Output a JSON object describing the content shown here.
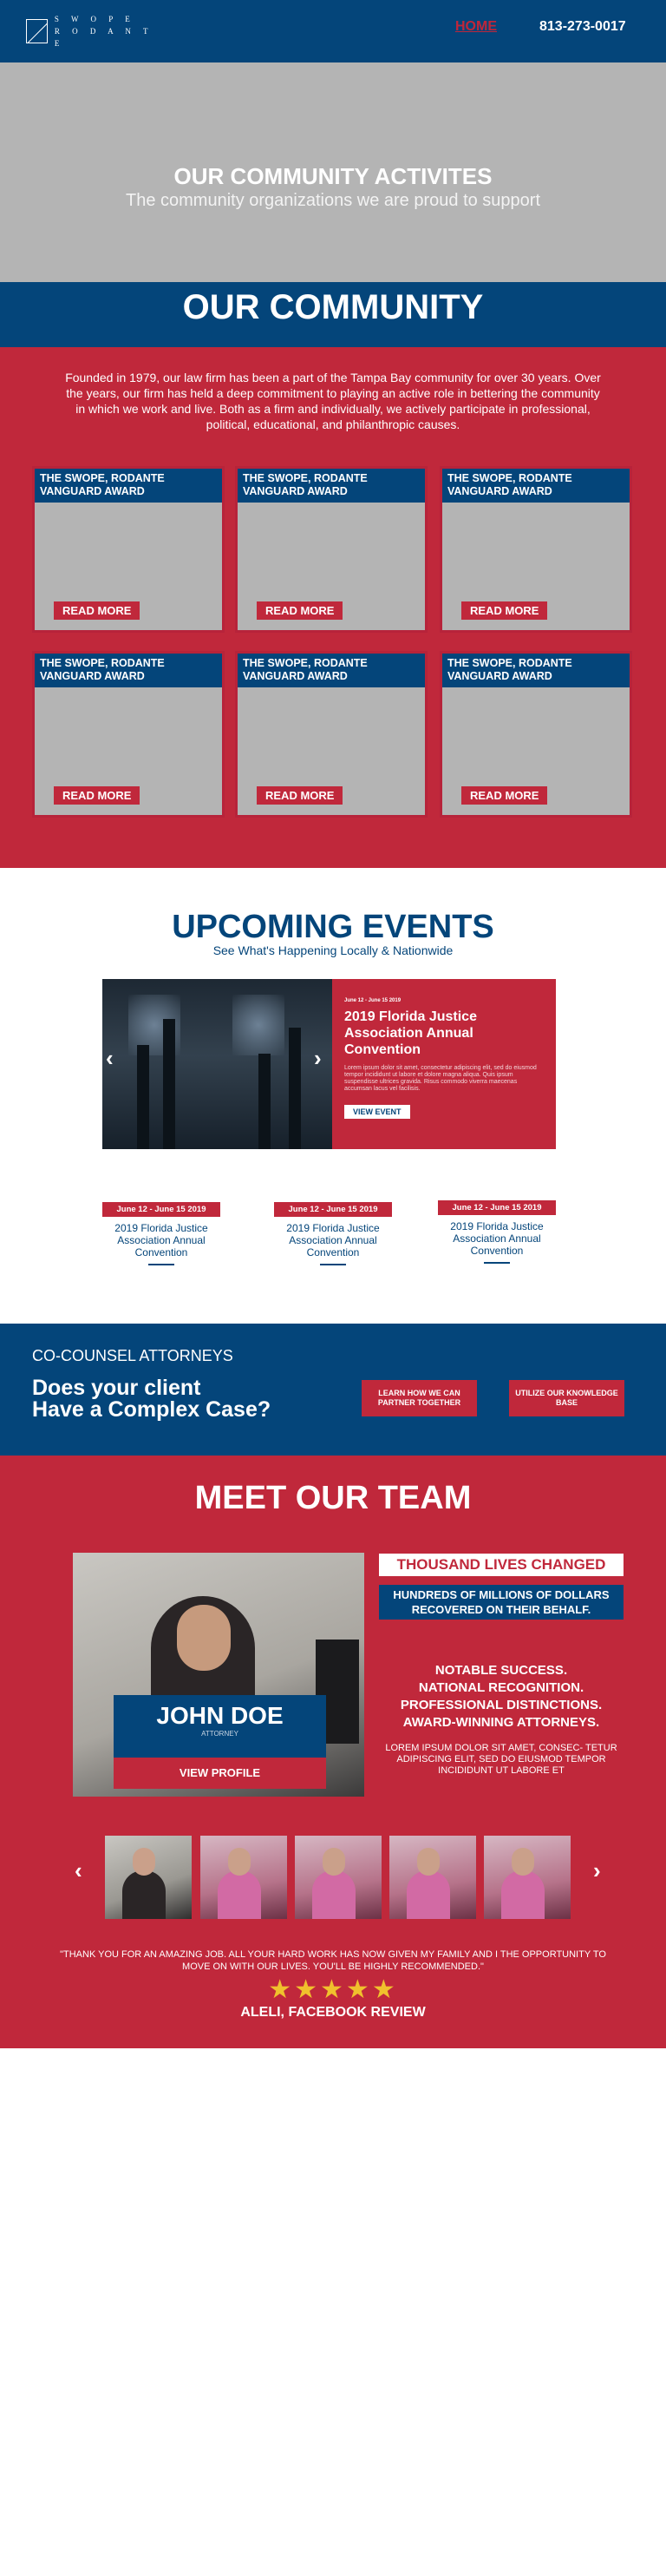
{
  "colors": {
    "brand_blue": "#04457a",
    "brand_red": "#c0283b",
    "gray": "#b4b4b4",
    "star": "#f0c12d"
  },
  "header": {
    "logo_top": "S W O P E",
    "logo_bottom": "R O D A N T E",
    "nav_home": "HOME",
    "phone": "813-273-0017"
  },
  "hero": {
    "title": "OUR COMMUNITY ACTIVITES",
    "subtitle": "The community organizations we are proud to support"
  },
  "community": {
    "title": "OUR COMMUNITY",
    "intro": "Founded in 1979, our law firm has been a part of the Tampa Bay community for over 30 years. Over the years, our firm has held a deep commitment to playing an active role in bettering the community in which we work and live. Both as a firm and individually, we actively participate in professional, political, educational, and philanthropic causes.",
    "cards": [
      {
        "title": "THE SWOPE, RODANTE VANGUARD AWARD",
        "button": "READ MORE"
      },
      {
        "title": "THE SWOPE, RODANTE VANGUARD AWARD",
        "button": "READ MORE"
      },
      {
        "title": "THE SWOPE, RODANTE VANGUARD AWARD",
        "button": "READ MORE"
      },
      {
        "title": "THE SWOPE, RODANTE VANGUARD AWARD",
        "button": "READ MORE"
      },
      {
        "title": "THE SWOPE, RODANTE VANGUARD AWARD",
        "button": "READ MORE"
      },
      {
        "title": "THE SWOPE, RODANTE VANGUARD AWARD",
        "button": "READ MORE"
      }
    ]
  },
  "events": {
    "title": "UPCOMING EVENTS",
    "subtitle": "See What's Happening Locally & Nationwide",
    "featured": {
      "date": "June 12 - June 15 2019",
      "title": "2019 Florida Justice Association Annual Convention",
      "body": "Lorem ipsum dolor sit amet, consectetur adipiscing elit, sed do eiusmod tempor incididunt ut labore et dolore magna aliqua. Quis ipsum suspendisse ultrices gravida. Risus commodo viverra maecenas accumsan lacus vel facilisis.",
      "button": "VIEW EVENT",
      "prev_glyph": "‹",
      "next_glyph": "›"
    },
    "list": [
      {
        "date": "June 12 - June 15 2019",
        "title": "2019 Florida Justice Association Annual Convention"
      },
      {
        "date": "June 12 - June 15 2019",
        "title": "2019 Florida Justice Association Annual Convention"
      },
      {
        "date": "June 12 - June 15 2019",
        "title": "2019 Florida Justice Association Annual Convention"
      }
    ]
  },
  "cocounsel": {
    "label": "CO-COUNSEL ATTORNEYS",
    "headline_1": "Does your client",
    "headline_2": "Have a Complex Case?",
    "button_1": "LEARN HOW WE CAN PARTNER TOGETHER",
    "button_2": "UTILIZE OUR KNOWLEDGE BASE"
  },
  "team": {
    "title": "MEET OUR TEAM",
    "member_name": "JOHN DOE",
    "member_role": "ATTORNEY",
    "profile_button": "VIEW PROFILE",
    "tagline_title": "THOUSAND LIVES CHANGED",
    "tagline_sub": "HUNDREDS OF MILLIONS OF DOLLARS RECOVERED ON THEIR BEHALF.",
    "success_1": "NOTABLE SUCCESS.",
    "success_2": "NATIONAL RECOGNITION.",
    "success_3": "PROFESSIONAL DISTINCTIONS.",
    "success_4": "AWARD-WINNING ATTORNEYS.",
    "lorem": "LOREM IPSUM DOLOR SIT AMET, CONSEC- TETUR ADIPISCING ELIT, SED DO EIUSMOD TEMPOR INCIDIDUNT UT LABORE ET",
    "prev_glyph": "‹",
    "next_glyph": "›",
    "review": "\"THANK YOU FOR AN AMAZING JOB. ALL YOUR HARD WORK HAS NOW GIVEN MY FAMILY AND I THE OPPORTUNITY TO MOVE ON WITH OUR LIVES. YOU'LL BE HIGHLY RECOMMENDED.\"",
    "rating": 5,
    "stars": "★★★★★",
    "reviewer": "ALELI, FACEBOOK REVIEW"
  }
}
